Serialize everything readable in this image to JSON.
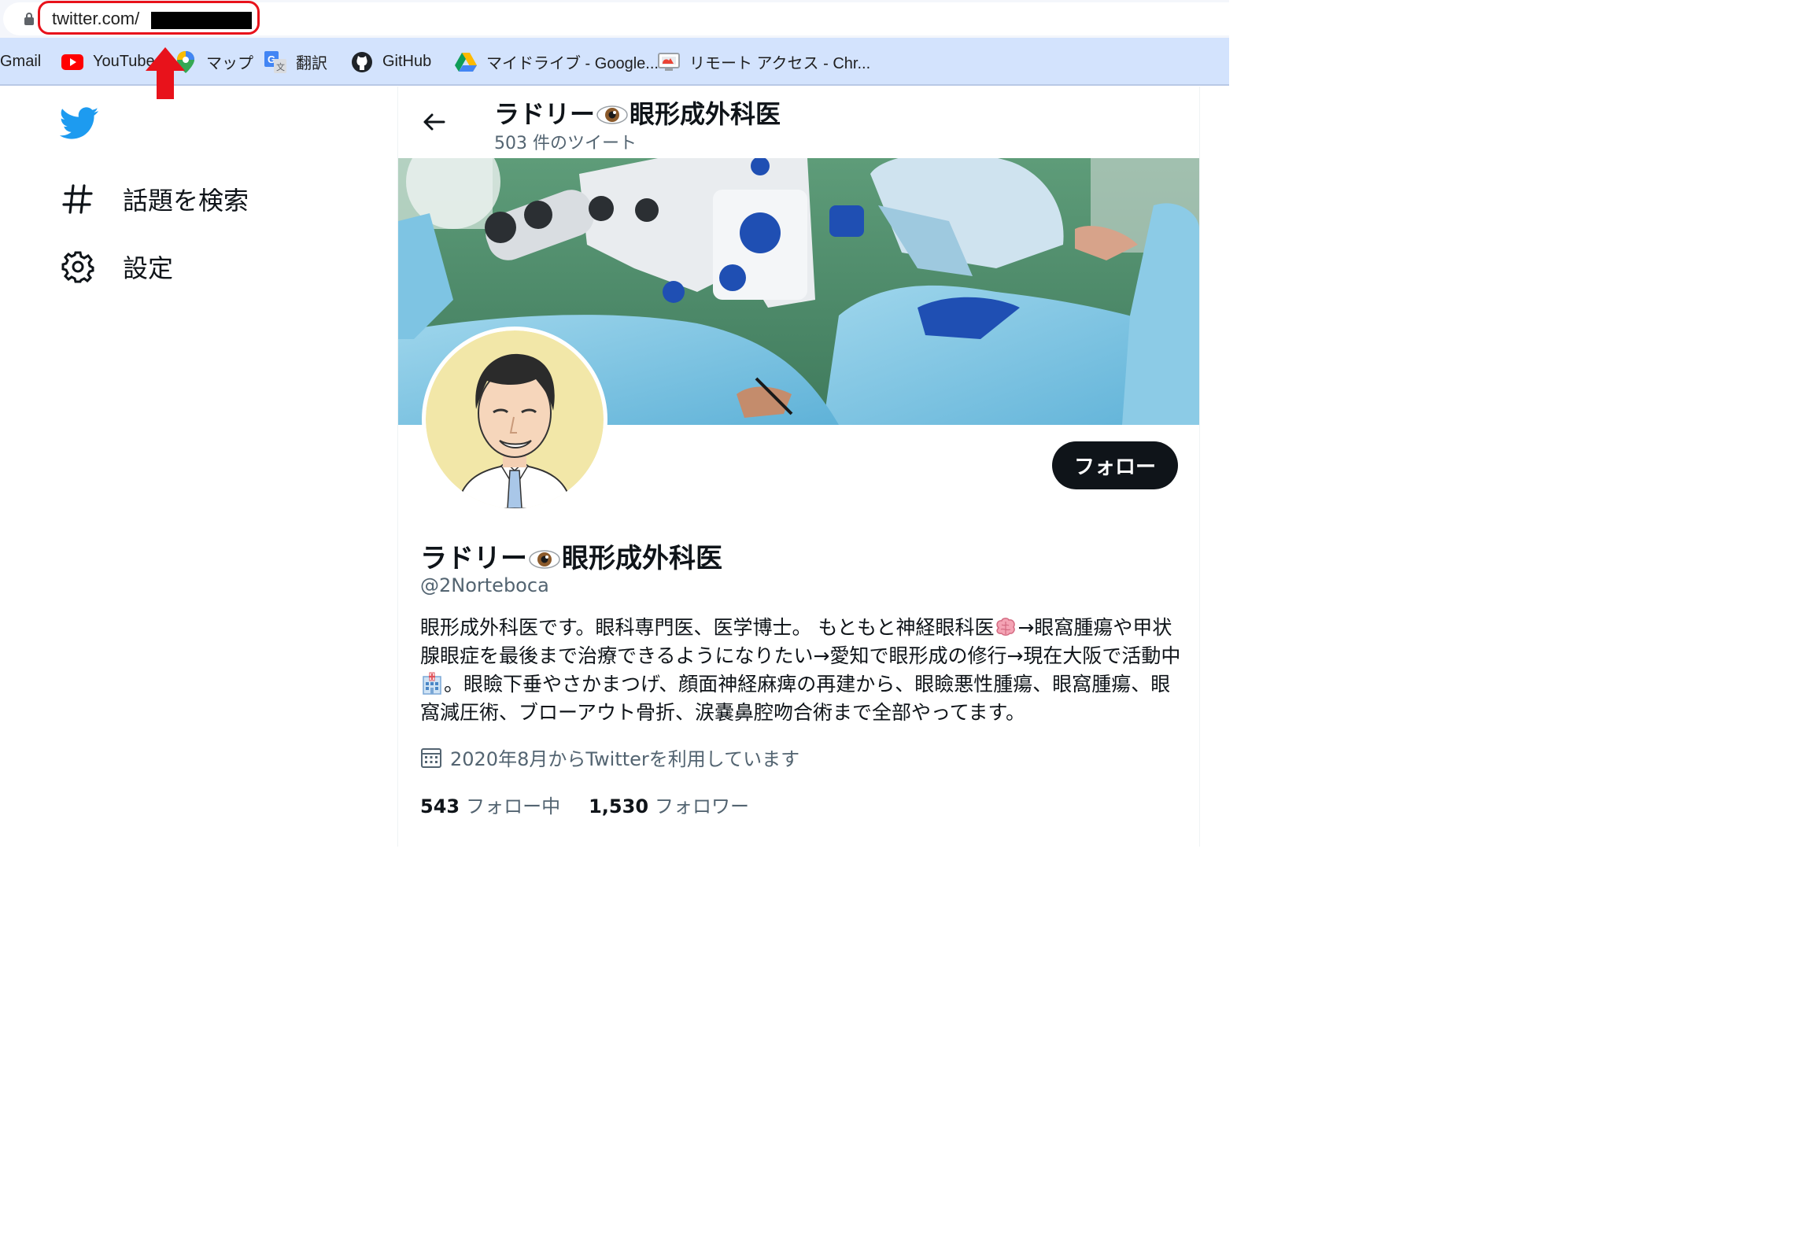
{
  "browser": {
    "url_prefix": "twitter.com/",
    "bookmarks": [
      {
        "label": "Gmail",
        "icon": "gmail-icon"
      },
      {
        "label": "YouTube",
        "icon": "youtube-icon"
      },
      {
        "label": "マップ",
        "icon": "maps-icon"
      },
      {
        "label": "翻訳",
        "icon": "translate-icon"
      },
      {
        "label": "GitHub",
        "icon": "github-icon"
      },
      {
        "label": "マイドライブ - Google...",
        "icon": "drive-icon"
      },
      {
        "label": "リモート アクセス - Chr...",
        "icon": "remote-desktop-icon"
      }
    ]
  },
  "nav": {
    "items": [
      {
        "label": "話題を検索",
        "icon": "hashtag-icon"
      },
      {
        "label": "設定",
        "icon": "gear-icon"
      }
    ]
  },
  "header": {
    "name_prefix": "ラドリー",
    "name_suffix": "眼形成外科医",
    "tweet_count": "503 件のツイート"
  },
  "profile": {
    "name_prefix": "ラドリー",
    "name_suffix": "眼形成外科医",
    "handle": "@2Norteboca",
    "follow_label": "フォロー",
    "bio_part1": "眼形成外科医です。眼科専門医、医学博士。 もともと神経眼科医",
    "bio_part2": "→眼窩腫瘍や甲状腺眼症を最後まで治療できるようになりたい→愛知で眼形成の修行→現在大阪で活動中",
    "bio_part3": "。眼瞼下垂やさかまつげ、顔面神経麻痺の再建から、眼瞼悪性腫瘍、眼窩腫瘍、眼窩減圧術、ブローアウト骨折、涙嚢鼻腔吻合術まで全部やってます。",
    "joined": "2020年8月からTwitterを利用しています",
    "following_count": "543",
    "following_label": "フォロー中",
    "followers_count": "1,530",
    "followers_label": "フォロワー"
  },
  "colors": {
    "twitter_blue": "#1d9bf0",
    "annotation_red": "#e8121b",
    "bookmark_bar": "#d3e3fd",
    "follow_button": "#0f1419"
  }
}
